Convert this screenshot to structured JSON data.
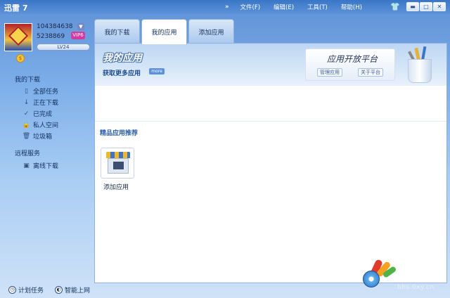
{
  "window": {
    "title": "迅雷 7",
    "menu": [
      "文件(F)",
      "编辑(E)",
      "工具(T)",
      "帮助(H)"
    ],
    "menu_toggle": "»",
    "skin_icon": "shirt-icon",
    "controls": [
      "▬",
      "□",
      "✕"
    ]
  },
  "account": {
    "id": "104384638",
    "dropdown": "▼",
    "score": "5238869",
    "vip": "VIP6",
    "level": "LV24",
    "coin": "$"
  },
  "sidebar": {
    "downloads_title": "我的下载",
    "items": [
      {
        "label": "全部任务",
        "icon": "document-icon",
        "glyph": "▯"
      },
      {
        "label": "正在下载",
        "icon": "down-arrow-icon",
        "glyph": "↓"
      },
      {
        "label": "已完成",
        "icon": "check-icon",
        "glyph": "✓"
      },
      {
        "label": "私人空间",
        "icon": "lock-icon",
        "glyph": "🔒"
      },
      {
        "label": "垃圾箱",
        "icon": "trash-icon",
        "glyph": "🗑"
      }
    ],
    "remote_title": "远程服务",
    "remote_items": [
      {
        "label": "离线下载",
        "icon": "offline-download-icon",
        "glyph": "▣"
      }
    ]
  },
  "bottom_bar": [
    {
      "label": "计划任务",
      "icon": "clock-icon",
      "glyph": "◷"
    },
    {
      "label": "智能上网",
      "icon": "smart-web-icon",
      "glyph": "◐"
    }
  ],
  "tabs": [
    {
      "label": "我的下载",
      "active": false
    },
    {
      "label": "我的应用",
      "active": true
    },
    {
      "label": "添加应用",
      "active": false
    }
  ],
  "main": {
    "title": "我的应用",
    "get_more": "获取更多应用",
    "more_badge": "more",
    "platform": {
      "title": "应用开放平台",
      "manage": "管理应用",
      "about": "关于平台"
    },
    "section_heading": "精品应用推荐",
    "apps": [
      {
        "label": "添加应用",
        "icon": "shop-icon"
      }
    ]
  },
  "watermark": {
    "text": "bbs.0xy.cn"
  }
}
